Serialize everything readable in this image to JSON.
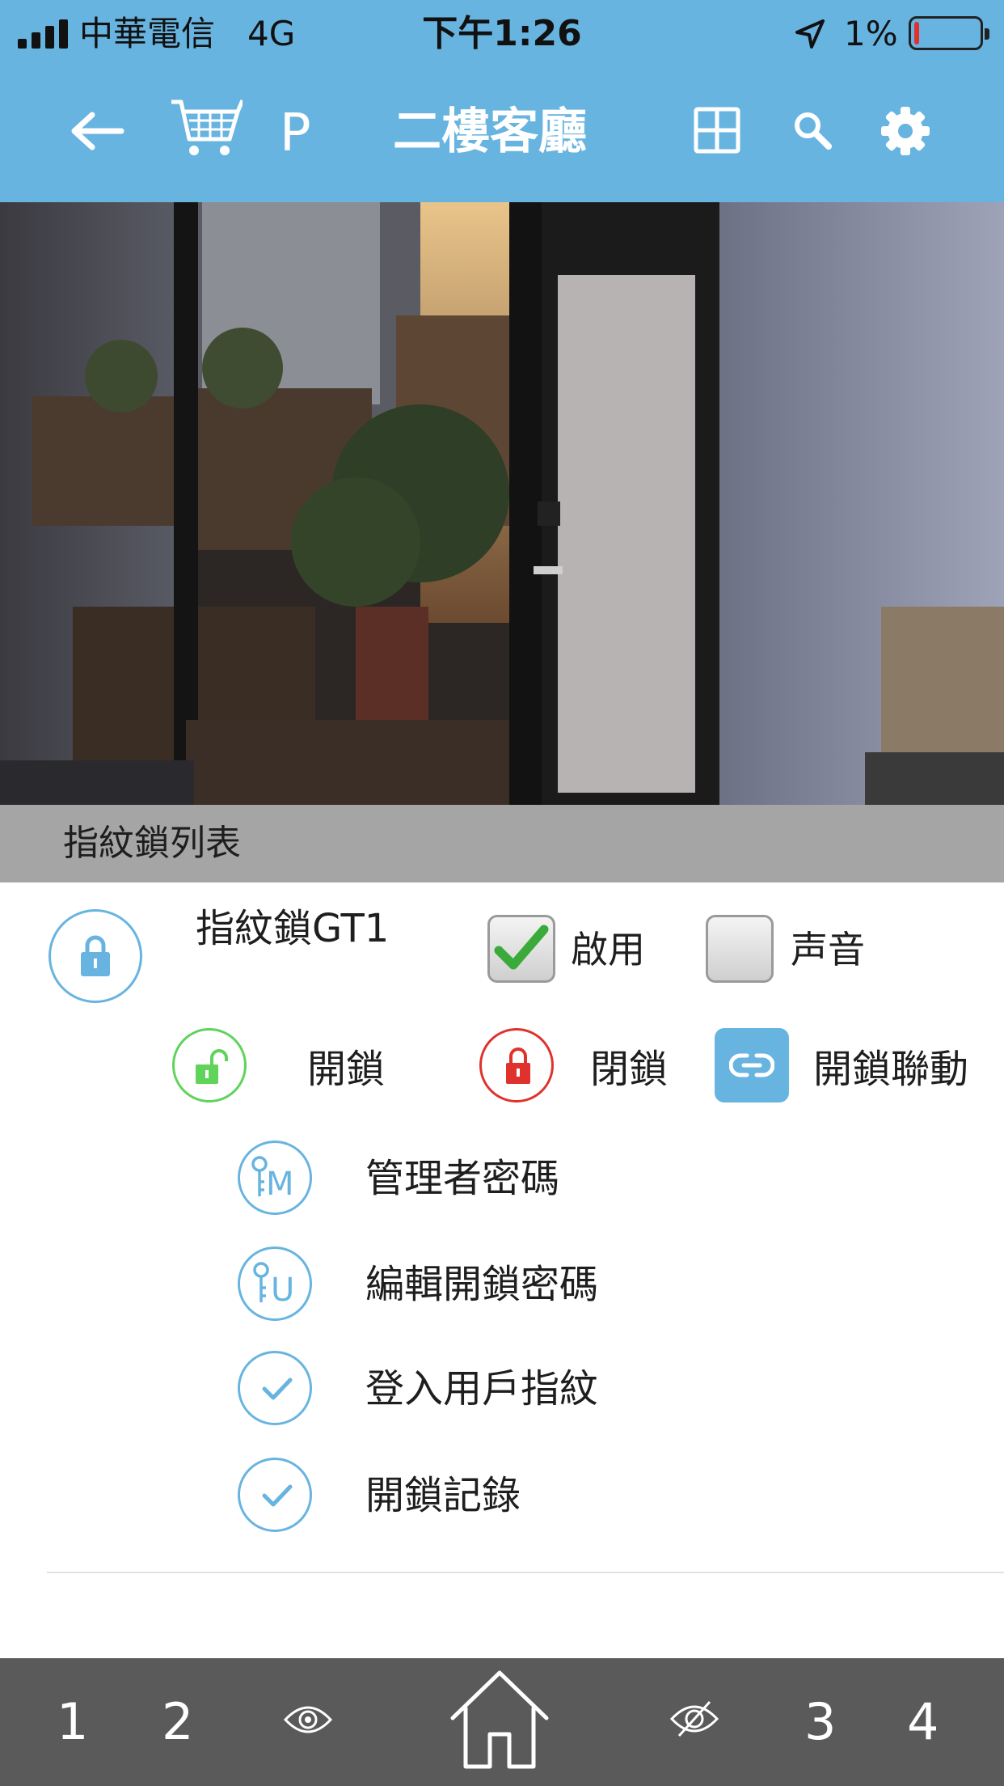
{
  "status_bar": {
    "carrier": "中華電信   4G",
    "time": "下午1:26",
    "battery_percent": "1%",
    "battery_level": 0.01,
    "icons": [
      "signal-icon",
      "location-arrow-icon",
      "battery-icon"
    ]
  },
  "nav": {
    "p_label": "P",
    "title": "二樓客廳",
    "icons": [
      "back-arrow-icon",
      "cart-icon",
      "grid-icon",
      "search-icon",
      "gear-icon"
    ]
  },
  "camera": {
    "icon": "camera-feed"
  },
  "section": {
    "title": "指紋鎖列表"
  },
  "lock": {
    "name": "指紋鎖GT1",
    "enable": {
      "label": "啟用",
      "checked": true
    },
    "sound": {
      "label": "声音",
      "checked": false
    },
    "actions": {
      "unlock_label": "開鎖",
      "lock_label": "閉鎖",
      "link_label": "開鎖聯動"
    },
    "menu": [
      {
        "label": "管理者密碼",
        "icon": "admin-key-icon"
      },
      {
        "label": "編輯開鎖密碼",
        "icon": "user-key-icon"
      },
      {
        "label": "登入用戶指紋",
        "icon": "check-icon"
      },
      {
        "label": "開鎖記錄",
        "icon": "check-icon"
      }
    ]
  },
  "bottom_bar": {
    "tab1": "1",
    "tab2": "2",
    "tab3": "3",
    "tab4": "4",
    "icons": [
      "eye-icon",
      "home-icon",
      "eye-off-icon"
    ]
  },
  "colors": {
    "header_blue": "#68b4e0",
    "section_gray": "#a5a5a5",
    "bottom_bar": "#5a5a5a",
    "unlock_green": "#5fd35a",
    "lock_red": "#e0322c",
    "check_green": "#3aaa3a"
  }
}
